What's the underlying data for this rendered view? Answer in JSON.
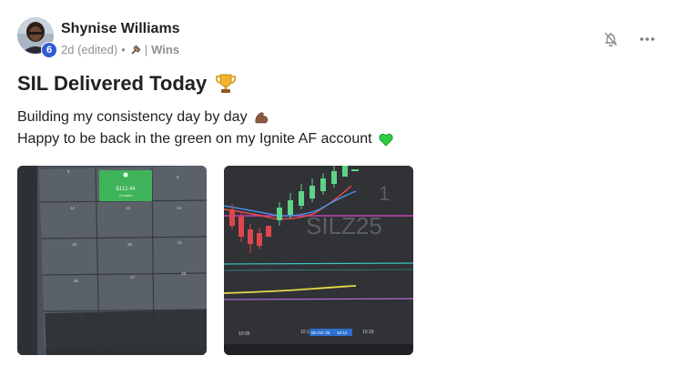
{
  "post": {
    "author": {
      "name": "Shynise Williams",
      "level": "6"
    },
    "meta": {
      "time": "2d (edited)",
      "category": "Wins"
    },
    "title": "SIL Delivered Today",
    "body": {
      "line1": "Building my consistency day by day",
      "line2": "Happy to be back in the green on my Ignite AF account"
    },
    "attachments": {
      "image1": {
        "cell_value": "$112.44",
        "cell_sub": "3 trades",
        "day_labels": [
          "5",
          "6",
          "12",
          "13",
          "14",
          "19",
          "20",
          "21",
          "26",
          "27",
          "28",
          "3"
        ]
      },
      "image2": {
        "watermark_symbol": "SILZ25",
        "watermark_tf": "1",
        "time_labels": [
          "10:05",
          "10:1",
          "10:19"
        ],
        "date_badge": "06 Oct '25",
        "time_badge": "10:12"
      }
    },
    "icons": {
      "bell": "bell-off-icon",
      "more": "more-horizontal-icon",
      "trophy": "trophy-emoji",
      "muscle": "flexed-biceps-emoji",
      "heart": "green-heart-emoji",
      "pin": "pushpin-icon"
    },
    "colors": {
      "badge": "#2f5bd3",
      "green_heart": "#2ecc40",
      "win_cell": "#3fb35a"
    }
  }
}
